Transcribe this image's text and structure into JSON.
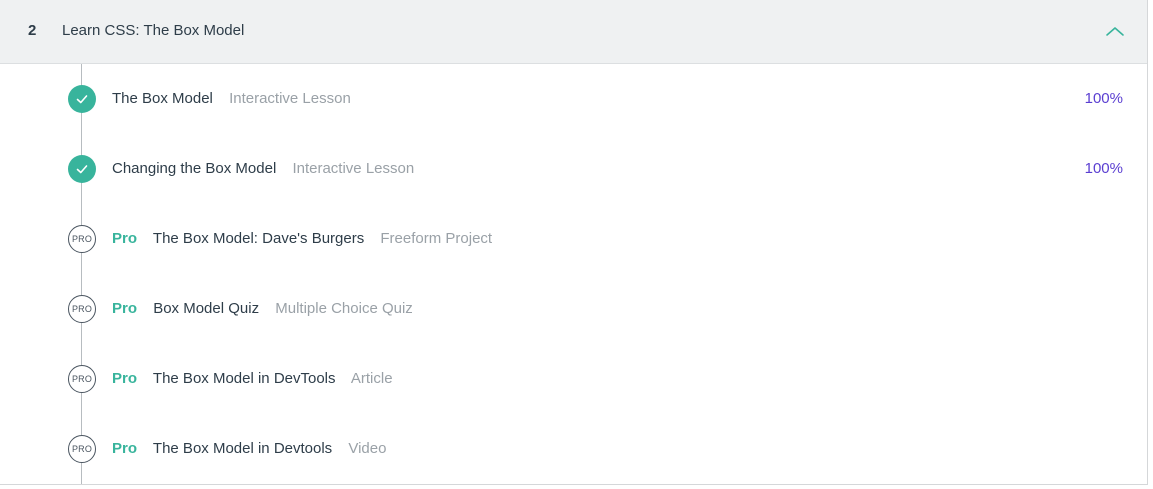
{
  "module": {
    "number": "2",
    "title": "Learn CSS: The Box Model",
    "collapse_icon": "chevron-up-icon",
    "accent_color": "#38b49c"
  },
  "lessons": [
    {
      "title": "The Box Model",
      "type": "Interactive Lesson",
      "progress": "100%",
      "status": "completed",
      "status_icon": "check-icon"
    },
    {
      "title": "Changing the Box Model",
      "type": "Interactive Lesson",
      "progress": "100%",
      "status": "completed",
      "status_icon": "check-icon"
    },
    {
      "pro": "Pro",
      "badge": "PRO",
      "title": "The Box Model: Dave's Burgers",
      "type": "Freeform Project",
      "status": "locked",
      "status_icon": "pro-badge-icon"
    },
    {
      "pro": "Pro",
      "badge": "PRO",
      "title": "Box Model Quiz",
      "type": "Multiple Choice Quiz",
      "status": "locked",
      "status_icon": "pro-badge-icon"
    },
    {
      "pro": "Pro",
      "badge": "PRO",
      "title": "The Box Model in DevTools",
      "type": "Article",
      "status": "locked",
      "status_icon": "pro-badge-icon"
    },
    {
      "pro": "Pro",
      "badge": "PRO",
      "title": "The Box Model in Devtools",
      "type": "Video",
      "status": "locked",
      "status_icon": "pro-badge-icon"
    }
  ]
}
